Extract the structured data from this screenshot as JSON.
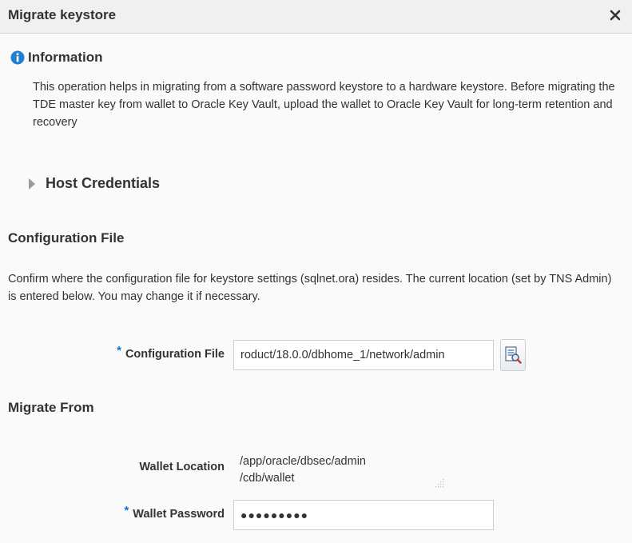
{
  "dialog": {
    "title": "Migrate keystore",
    "close_icon": "close-icon"
  },
  "information": {
    "icon": "info-icon",
    "title": "Information",
    "text": "This operation helps in migrating from a software password keystore to a hardware keystore. Before migrating the TDE master key from wallet to Oracle Key Vault, upload the wallet to Oracle Key Vault for long-term retention and recovery"
  },
  "host_credentials": {
    "icon": "disclosure-triangle-icon",
    "label": "Host Credentials",
    "expanded": false
  },
  "configuration_file": {
    "heading": "Configuration File",
    "description": "Confirm where the configuration file for keystore settings (sqlnet.ora) resides. The current location (set by TNS Admin) is entered below. You may change it if necessary.",
    "field_label": "Configuration File",
    "required_marker": "*",
    "field_value": "roduct/18.0.0/dbhome_1/network/admin",
    "browse_icon": "search-document-icon"
  },
  "migrate_from": {
    "heading": "Migrate From",
    "wallet_location_label": "Wallet Location",
    "wallet_location_line1": "/app/oracle/dbsec/admin",
    "wallet_location_line2": "/cdb/wallet",
    "wallet_password_label": "Wallet Password",
    "required_marker": "*",
    "wallet_password_value": "●●●●●●●●●"
  },
  "colors": {
    "accent": "#0a76d8",
    "text": "#333333",
    "background": "#fafafa",
    "titlebar": "#f0f0f0"
  }
}
